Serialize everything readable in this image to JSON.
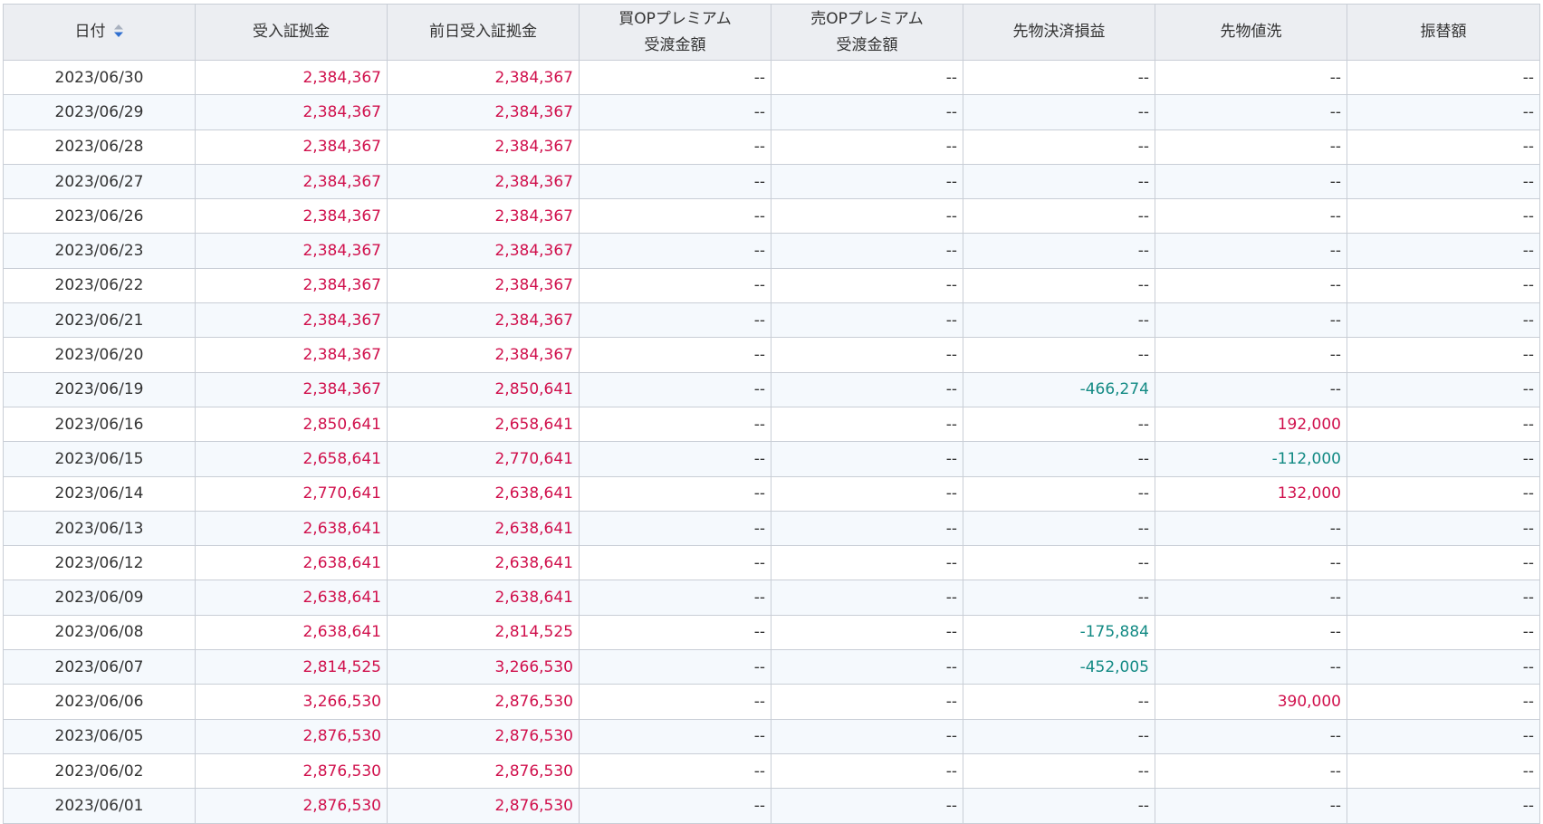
{
  "table": {
    "headers": [
      {
        "line1": "日付",
        "line2": ""
      },
      {
        "line1": "受入証拠金",
        "line2": ""
      },
      {
        "line1": "前日受入証拠金",
        "line2": ""
      },
      {
        "line1": "買OPプレミアム",
        "line2": "受渡金額"
      },
      {
        "line1": "売OPプレミアム",
        "line2": "受渡金額"
      },
      {
        "line1": "先物決済損益",
        "line2": ""
      },
      {
        "line1": "先物値洗",
        "line2": ""
      },
      {
        "line1": "振替額",
        "line2": ""
      }
    ],
    "sort_icon": "sort-asc-desc-icon",
    "colors": {
      "positive": "#d0104c",
      "negative": "#138a84",
      "header_bg": "#eceef2",
      "stripe": "#f5f9fd",
      "sort_up": "#a9b1bf",
      "sort_down": "#2f6fd0"
    },
    "rows": [
      [
        "2023/06/30",
        "2,384,367",
        "2,384,367",
        "--",
        "--",
        "--",
        "--",
        "--"
      ],
      [
        "2023/06/29",
        "2,384,367",
        "2,384,367",
        "--",
        "--",
        "--",
        "--",
        "--"
      ],
      [
        "2023/06/28",
        "2,384,367",
        "2,384,367",
        "--",
        "--",
        "--",
        "--",
        "--"
      ],
      [
        "2023/06/27",
        "2,384,367",
        "2,384,367",
        "--",
        "--",
        "--",
        "--",
        "--"
      ],
      [
        "2023/06/26",
        "2,384,367",
        "2,384,367",
        "--",
        "--",
        "--",
        "--",
        "--"
      ],
      [
        "2023/06/23",
        "2,384,367",
        "2,384,367",
        "--",
        "--",
        "--",
        "--",
        "--"
      ],
      [
        "2023/06/22",
        "2,384,367",
        "2,384,367",
        "--",
        "--",
        "--",
        "--",
        "--"
      ],
      [
        "2023/06/21",
        "2,384,367",
        "2,384,367",
        "--",
        "--",
        "--",
        "--",
        "--"
      ],
      [
        "2023/06/20",
        "2,384,367",
        "2,384,367",
        "--",
        "--",
        "--",
        "--",
        "--"
      ],
      [
        "2023/06/19",
        "2,384,367",
        "2,850,641",
        "--",
        "--",
        "-466,274",
        "--",
        "--"
      ],
      [
        "2023/06/16",
        "2,850,641",
        "2,658,641",
        "--",
        "--",
        "--",
        "192,000",
        "--"
      ],
      [
        "2023/06/15",
        "2,658,641",
        "2,770,641",
        "--",
        "--",
        "--",
        "-112,000",
        "--"
      ],
      [
        "2023/06/14",
        "2,770,641",
        "2,638,641",
        "--",
        "--",
        "--",
        "132,000",
        "--"
      ],
      [
        "2023/06/13",
        "2,638,641",
        "2,638,641",
        "--",
        "--",
        "--",
        "--",
        "--"
      ],
      [
        "2023/06/12",
        "2,638,641",
        "2,638,641",
        "--",
        "--",
        "--",
        "--",
        "--"
      ],
      [
        "2023/06/09",
        "2,638,641",
        "2,638,641",
        "--",
        "--",
        "--",
        "--",
        "--"
      ],
      [
        "2023/06/08",
        "2,638,641",
        "2,814,525",
        "--",
        "--",
        "-175,884",
        "--",
        "--"
      ],
      [
        "2023/06/07",
        "2,814,525",
        "3,266,530",
        "--",
        "--",
        "-452,005",
        "--",
        "--"
      ],
      [
        "2023/06/06",
        "3,266,530",
        "2,876,530",
        "--",
        "--",
        "--",
        "390,000",
        "--"
      ],
      [
        "2023/06/05",
        "2,876,530",
        "2,876,530",
        "--",
        "--",
        "--",
        "--",
        "--"
      ],
      [
        "2023/06/02",
        "2,876,530",
        "2,876,530",
        "--",
        "--",
        "--",
        "--",
        "--"
      ],
      [
        "2023/06/01",
        "2,876,530",
        "2,876,530",
        "--",
        "--",
        "--",
        "--",
        "--"
      ]
    ]
  }
}
